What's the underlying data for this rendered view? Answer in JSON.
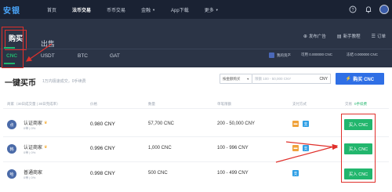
{
  "topnav": {
    "logo": "安银",
    "items": [
      {
        "label": "首页",
        "active": false
      },
      {
        "label": "法币交易",
        "active": true
      },
      {
        "label": "币币交易",
        "active": false
      },
      {
        "label": "金融",
        "active": false,
        "dropdown": true
      },
      {
        "label": "App下载",
        "active": false
      },
      {
        "label": "更多",
        "active": false,
        "dropdown": true
      }
    ],
    "icons": [
      "question-icon",
      "bell-icon",
      "user-avatar"
    ]
  },
  "subtabs": [
    {
      "label": "购买",
      "active": true
    },
    {
      "label": "出售",
      "active": false
    }
  ],
  "toolbar": [
    {
      "icon": "publish-icon",
      "label": "发布广告"
    },
    {
      "icon": "book-icon",
      "label": "新手教程"
    },
    {
      "icon": "order-icon",
      "label": "订单"
    }
  ],
  "coins": [
    {
      "label": "CNC",
      "active": true
    },
    {
      "label": "USDT",
      "active": false
    },
    {
      "label": "BTC",
      "active": false
    },
    {
      "label": "GAT",
      "active": false
    }
  ],
  "assets": {
    "my_assets": "我的资产",
    "available": "可用 0.000000 CNC",
    "frozen": "冻结 0.000000 CNC"
  },
  "quick_buy": {
    "title": "一键买币",
    "subtitle": "1万内极速成交，0手续费",
    "select_label": "按金额购买",
    "input_placeholder": "限额 100 - 50,000 CNY",
    "unit": "CNY",
    "button_label": "购买 CNC"
  },
  "table": {
    "headers": {
      "merchant": "商家（30日成交量 | 30日完成率）",
      "price": "价格",
      "quantity": "数量",
      "limit": "单笔限额",
      "payment": "支付方式",
      "action": "交易",
      "fee": "0手续费"
    },
    "rows": [
      {
        "avatar": "点",
        "name": "认证商家",
        "stats": "0单 | 0%",
        "price": "0.980 CNY",
        "quantity": "57,700 CNC",
        "limit": "200 - 50,000 CNY",
        "payments": [
          "bank",
          "alipay"
        ],
        "action": "买入 CNC"
      },
      {
        "avatar": "韩",
        "name": "认证商家",
        "stats": "0单 | 0%",
        "price": "0.996 CNY",
        "quantity": "1,000 CNC",
        "limit": "100 - 996 CNY",
        "payments": [
          "bank",
          "alipay"
        ],
        "action": "买入 CNC"
      },
      {
        "avatar": "哈",
        "name": "普通商家",
        "stats": "0单 | 0%",
        "price": "0.998 CNY",
        "quantity": "500 CNC",
        "limit": "100 - 499 CNY",
        "payments": [
          "alipay"
        ],
        "action": "买入 CNC"
      }
    ]
  },
  "colors": {
    "nav_bg": "#1a2233",
    "band_bg": "#2b3446",
    "accent_green": "#22b66d",
    "accent_blue": "#2f6fe5",
    "annotation_red": "#e0302b"
  }
}
